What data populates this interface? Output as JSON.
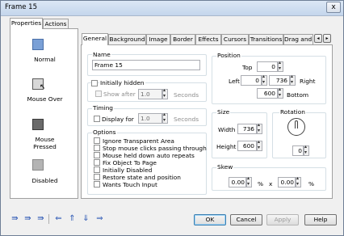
{
  "window": {
    "title": "Frame 15",
    "close_glyph": "x"
  },
  "left_tabs": {
    "properties": "Properties",
    "actions": "Actions"
  },
  "states": [
    {
      "label": "Normal",
      "icon": "normal-state-icon"
    },
    {
      "label": "Mouse Over",
      "icon": "mouse-over-state-icon"
    },
    {
      "label_line1": "Mouse",
      "label_line2": "Pressed",
      "icon": "mouse-pressed-state-icon"
    },
    {
      "label": "Disabled",
      "icon": "disabled-state-icon"
    }
  ],
  "right_tabs": [
    "General",
    "Background",
    "Image",
    "Border",
    "Effects",
    "Cursors",
    "Transitions",
    "Drag and I"
  ],
  "tab_scroll": {
    "left": "◂",
    "right": "▸"
  },
  "name_group": {
    "label": "Name",
    "value": "Frame 15"
  },
  "hidden_group": {
    "initially_hidden": "Initially hidden",
    "show_after": "Show after",
    "show_after_value": "1.0",
    "seconds": "Seconds"
  },
  "timing_group": {
    "label": "Timing",
    "display_for": "Display for",
    "display_value": "1.0",
    "seconds": "Seconds"
  },
  "options_group": {
    "label": "Options",
    "items": [
      "Ignore Transparent Area",
      "Stop mouse clicks passing through",
      "Mouse held down auto repeats",
      "Fix Object To Page",
      "Initially Disabled",
      "Restore state and position",
      "Wants Touch Input"
    ]
  },
  "position_group": {
    "label": "Position",
    "top_label": "Top",
    "top": "0",
    "left_label": "Left",
    "left": "0",
    "right_label": "Right",
    "right": "736",
    "bottom_label": "Bottom",
    "bottom": "600"
  },
  "size_group": {
    "label": "Size",
    "width_label": "Width",
    "width": "736",
    "height_label": "Height",
    "height": "600"
  },
  "rotation_group": {
    "label": "Rotation",
    "value": "0"
  },
  "skew_group": {
    "label": "Skew",
    "x": "0.00",
    "y": "0.00",
    "unit1": "%",
    "times": "x",
    "unit2": "%"
  },
  "buttons": {
    "ok": "OK",
    "cancel": "Cancel",
    "apply": "Apply",
    "help": "Help"
  },
  "bottom_icons": [
    "copy-to-state-icon",
    "paste-state-icon",
    "reset-state-icon",
    "left-arrow-icon",
    "up-arrow-icon",
    "down-arrow-icon",
    "right-arrow-icon"
  ]
}
